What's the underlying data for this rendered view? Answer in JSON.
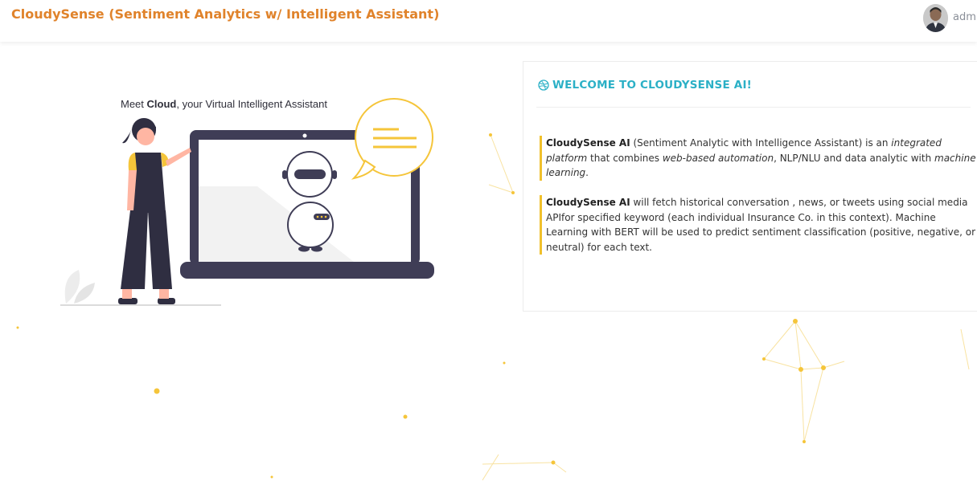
{
  "header": {
    "title": "CloudySense (Sentiment Analytics w/ Intelligent Assistant)",
    "username": "admi"
  },
  "hero": {
    "caption_prefix": "Meet ",
    "caption_bold": "Cloud",
    "caption_suffix": ", your Virtual Intelligent Assistant"
  },
  "welcome": {
    "title": "WELCOME TO CLOUDYSENSE AI!",
    "icon": "dribbble-icon",
    "p1": {
      "brand": "CloudySense AI",
      "t1": " (Sentiment Analytic with Intelligence Assistant) is an ",
      "em1": "integrated platform",
      "t2": " that combines ",
      "em2": "web-based automation",
      "t3": ", NLP/NLU and data analytic with ",
      "em3": "machine learning",
      "t4": "."
    },
    "p2": {
      "brand": "CloudySense AI",
      "text": " will fetch historical conversation , news, or tweets using social media APIfor specified keyword (each individual Insurance Co. in this context). Machine Learning with BERT will be used to predict sentiment classification (positive, negative, or neutral) for each text."
    }
  },
  "colors": {
    "brand_orange": "#e0832b",
    "accent_teal": "#2bb0c6",
    "accent_yellow": "#f0c02c",
    "laptop_dark": "#3f3d56"
  }
}
